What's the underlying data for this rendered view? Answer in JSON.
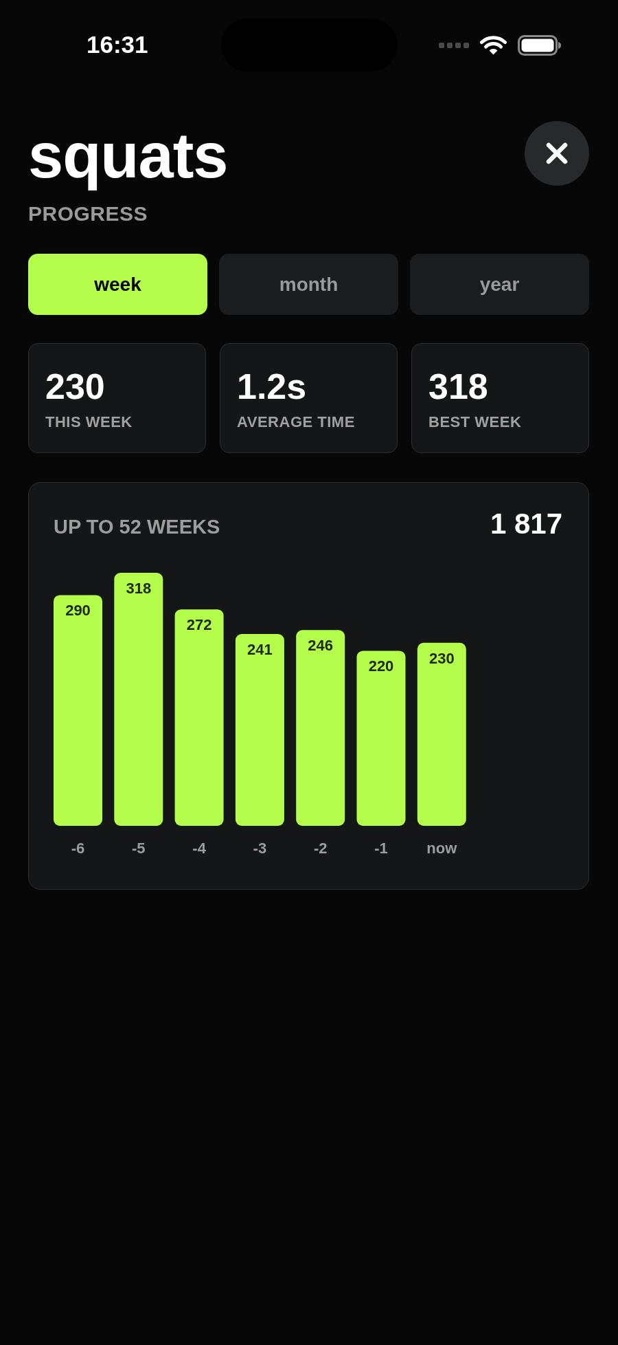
{
  "status_bar": {
    "time": "16:31"
  },
  "header": {
    "title": "squats",
    "subtitle": "PROGRESS"
  },
  "tabs": [
    {
      "label": "week",
      "selected": true
    },
    {
      "label": "month",
      "selected": false
    },
    {
      "label": "year",
      "selected": false
    }
  ],
  "stats": [
    {
      "value": "230",
      "label": "THIS WEEK"
    },
    {
      "value": "1.2s",
      "label": "AVERAGE TIME"
    },
    {
      "value": "318",
      "label": "BEST WEEK"
    }
  ],
  "chart_card": {
    "title": "UP TO 52 WEEKS",
    "total": "1 817",
    "chart_data": {
      "type": "bar",
      "categories": [
        "-6",
        "-5",
        "-4",
        "-3",
        "-2",
        "-1",
        "now"
      ],
      "values": [
        290,
        318,
        272,
        241,
        246,
        220,
        230
      ],
      "data_labels": true
    }
  }
}
